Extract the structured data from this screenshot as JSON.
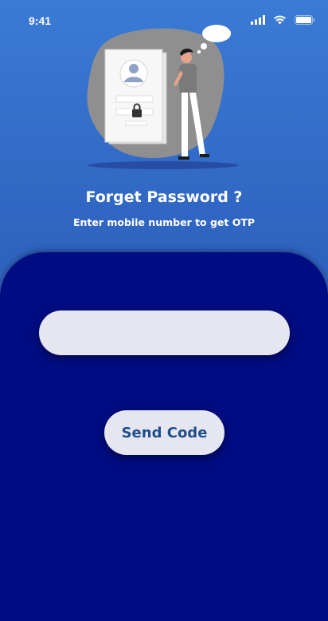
{
  "status_bar": {
    "time": "9:41",
    "icons": [
      "signal-icon",
      "wifi-icon",
      "battery-icon"
    ]
  },
  "illustration": {
    "password_mask": "•••••"
  },
  "header": {
    "title": "Forget Password ?",
    "subtitle": "Enter mobile number to get OTP"
  },
  "form": {
    "phone_value": "",
    "send_label": "Send Code"
  },
  "colors": {
    "background_top": "#3a7bd5",
    "panel": "#000c82",
    "input_bg": "#e6e6f0",
    "button_text": "#1f4e8c"
  }
}
